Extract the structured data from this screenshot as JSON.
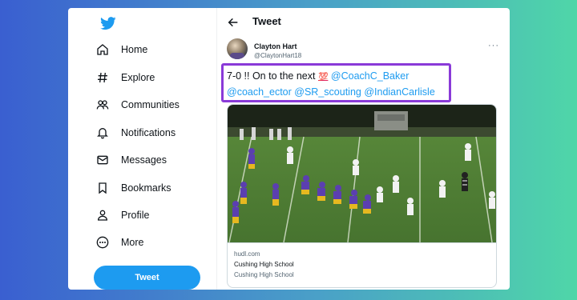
{
  "colors": {
    "accent": "#1d9bf0",
    "highlight_border": "#8a3ad8",
    "text": "#0f1419",
    "muted": "#536471"
  },
  "sidebar": {
    "logo_icon": "twitter-bird-icon",
    "items": [
      {
        "label": "Home",
        "icon": "home-icon"
      },
      {
        "label": "Explore",
        "icon": "hashtag-icon"
      },
      {
        "label": "Communities",
        "icon": "communities-icon"
      },
      {
        "label": "Notifications",
        "icon": "bell-icon"
      },
      {
        "label": "Messages",
        "icon": "envelope-icon"
      },
      {
        "label": "Bookmarks",
        "icon": "bookmark-icon"
      },
      {
        "label": "Profile",
        "icon": "person-icon"
      },
      {
        "label": "More",
        "icon": "more-circle-icon"
      }
    ],
    "tweet_button": "Tweet"
  },
  "header": {
    "back_icon": "back-arrow-icon",
    "title": "Tweet"
  },
  "tweet": {
    "author_name": "Clayton Hart",
    "author_handle": "@ClaytonHart18",
    "more_label": "···",
    "text_prefix": "7-0 !! On to the next",
    "emoji": "💯",
    "mentions": [
      "@CoachC_Baker",
      "@coach_ector",
      "@SR_scouting",
      "@IndianCarlisle"
    ]
  },
  "card": {
    "domain": "hudl.com",
    "title": "Cushing High School",
    "description": "Cushing High School"
  }
}
